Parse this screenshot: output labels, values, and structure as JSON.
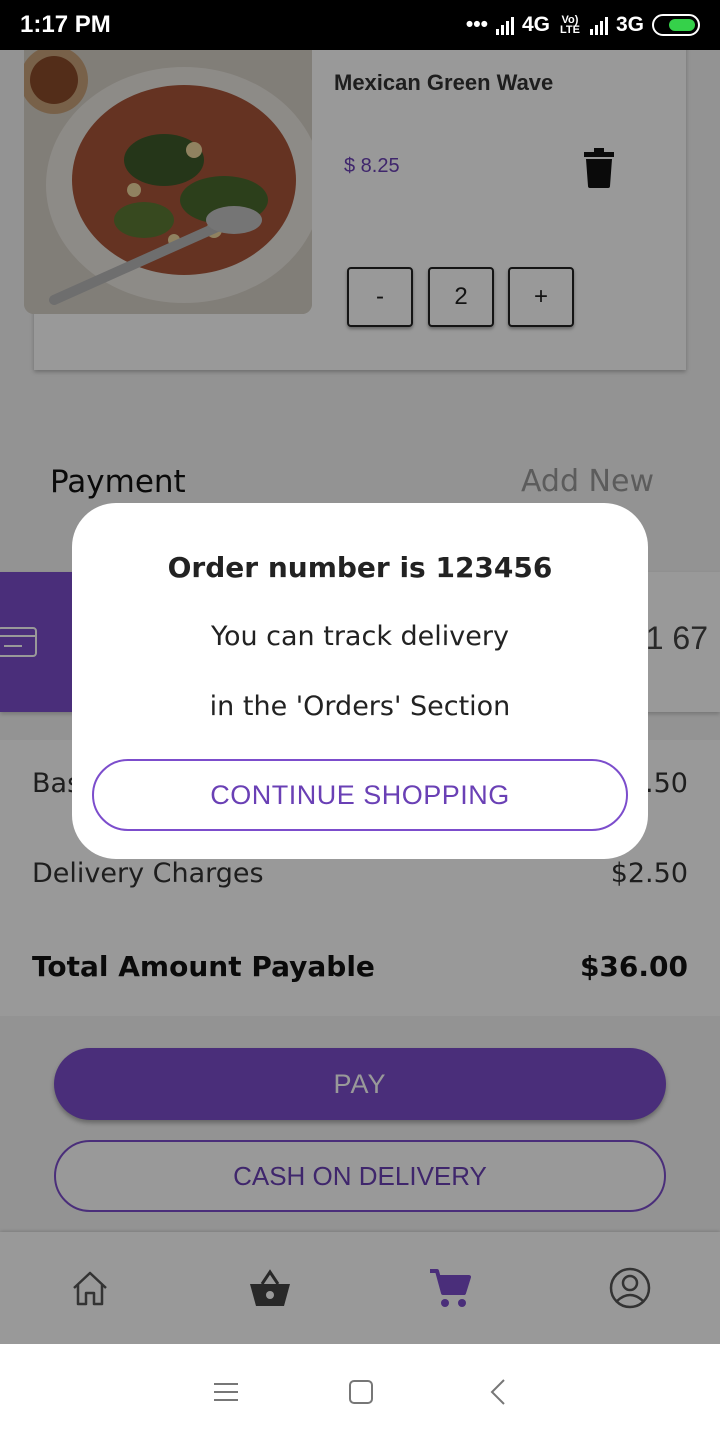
{
  "status_bar": {
    "time": "1:17 PM",
    "network_1": "4G",
    "volte": "Vo) LTE",
    "network_2": "3G"
  },
  "cart_item": {
    "name": "Mexican Green Wave",
    "price": "$ 8.25",
    "decrement": "-",
    "quantity": "2",
    "increment": "+"
  },
  "payment": {
    "title": "Payment",
    "add_new": "Add New",
    "card_number_partial": "1 67"
  },
  "summary": {
    "base_label_partial": "Bas",
    "base_value_partial": ".50",
    "delivery_label": "Delivery Charges",
    "delivery_value": "$2.50",
    "total_label": "Total Amount Payable",
    "total_value": "$36.00"
  },
  "actions": {
    "pay": "PAY",
    "cash_on_delivery": "CASH ON DELIVERY"
  },
  "bottom_nav": {
    "items": [
      "home-icon",
      "basket-icon",
      "cart-icon",
      "profile-icon"
    ],
    "active_index": 2
  },
  "dialog": {
    "title": "Order number is 123456",
    "line1": "You can track delivery",
    "line2": "in the 'Orders' Section",
    "button": "CONTINUE SHOPPING"
  },
  "colors": {
    "accent": "#7c4dcc",
    "accent_text": "#6a40b5"
  }
}
